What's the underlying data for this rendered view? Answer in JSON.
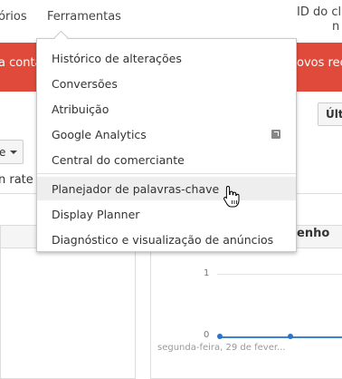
{
  "nav": {
    "relatorios": "órios",
    "ferramentas": "Ferramentas",
    "client_id_line1": "ID do clie",
    "client_id_line2": "n"
  },
  "banner": {
    "left_text": "a conta",
    "right_text": "ovos recu",
    "color": "#e04a3b"
  },
  "content": {
    "ultimo_button": "Últi",
    "small_select_label": "e",
    "rate_label": "n rate",
    "performance_title": "enho",
    "chart": {
      "y_ticks": [
        "1",
        "0"
      ],
      "x_label": "segunda-feira, 29 de fever..."
    }
  },
  "menu": {
    "items": [
      {
        "label": "Histórico de alterações"
      },
      {
        "label": "Conversões"
      },
      {
        "label": "Atribuição"
      },
      {
        "label": "Google Analytics",
        "icon": "external-link-icon"
      },
      {
        "label": "Central do comerciante"
      },
      {
        "label": "Planejador de palavras-chave",
        "hovered": true
      },
      {
        "label": "Display Planner"
      },
      {
        "label": "Diagnóstico e visualização de anúncios"
      }
    ]
  }
}
